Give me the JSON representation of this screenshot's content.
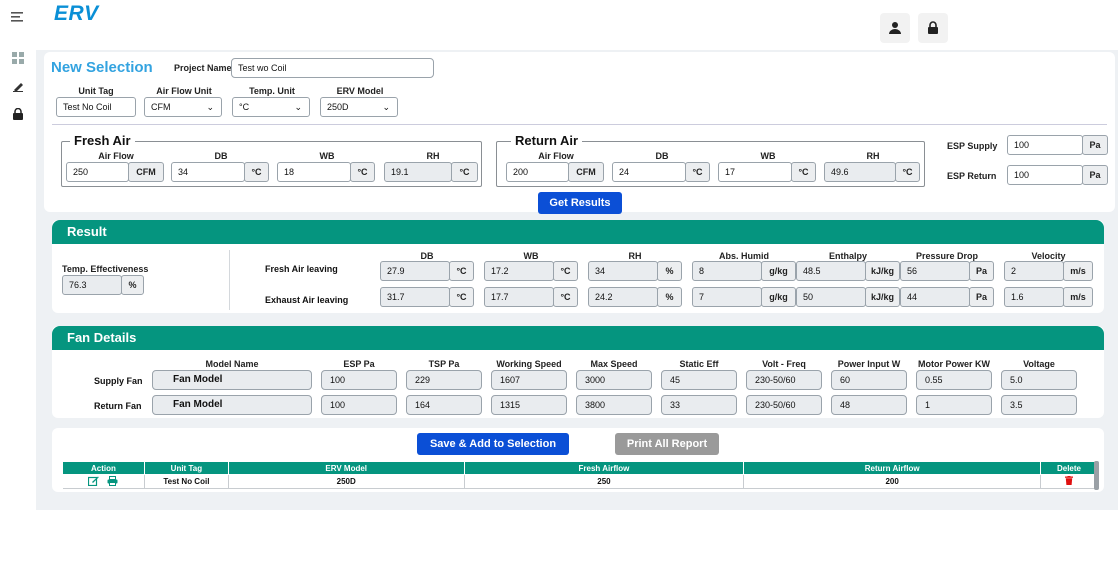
{
  "app": {
    "brand": "ERV"
  },
  "rail": {
    "icons": [
      "hamburger-icon",
      "grid-icon",
      "pen-icon",
      "lock-icon"
    ]
  },
  "header": {
    "title": "New Selection",
    "project_name_label": "Project Name",
    "project_name_value": "Test wo Coil"
  },
  "selectors": {
    "unit_tag": {
      "label": "Unit Tag",
      "value": "Test No Coil"
    },
    "airflow_unit": {
      "label": "Air Flow Unit",
      "value": "CFM"
    },
    "temp_unit": {
      "label": "Temp. Unit",
      "value": "°C"
    },
    "erv_model": {
      "label": "ERV Model",
      "value": "250D"
    }
  },
  "fresh_air": {
    "legend": "Fresh Air",
    "airflow": {
      "label": "Air Flow",
      "value": "250",
      "unit": "CFM"
    },
    "db": {
      "label": "DB",
      "value": "34",
      "unit": "°C"
    },
    "wb": {
      "label": "WB",
      "value": "18",
      "unit": "°C"
    },
    "rh": {
      "label": "RH",
      "value": "19.1",
      "unit": "°C"
    }
  },
  "return_air": {
    "legend": "Return Air",
    "airflow": {
      "label": "Air Flow",
      "value": "200",
      "unit": "CFM"
    },
    "db": {
      "label": "DB",
      "value": "24",
      "unit": "°C"
    },
    "wb": {
      "label": "WB",
      "value": "17",
      "unit": "°C"
    },
    "rh": {
      "label": "RH",
      "value": "49.6",
      "unit": "°C"
    }
  },
  "esp": {
    "supply": {
      "label": "ESP Supply",
      "value": "100",
      "unit": "Pa"
    },
    "return": {
      "label": "ESP Return",
      "value": "100",
      "unit": "Pa"
    }
  },
  "buttons": {
    "get_results": "Get Results",
    "save_add": "Save & Add to Selection",
    "print_all": "Print All Report"
  },
  "result": {
    "title": "Result",
    "temp_eff": {
      "label": "Temp. Effectiveness",
      "value": "76.3",
      "unit": "%"
    },
    "headers": [
      "DB",
      "WB",
      "RH",
      "Abs. Humid",
      "Enthalpy",
      "Pressure Drop",
      "Velocity"
    ],
    "rows": [
      {
        "label": "Fresh Air leaving",
        "values": [
          "27.9",
          "17.2",
          "34",
          "8",
          "48.5",
          "56",
          "2"
        ],
        "units": [
          "°C",
          "°C",
          "%",
          "g/kg",
          "kJ/kg",
          "Pa",
          "m/s"
        ]
      },
      {
        "label": "Exhaust Air leaving",
        "values": [
          "31.7",
          "17.7",
          "24.2",
          "7",
          "50",
          "44",
          "1.6"
        ],
        "units": [
          "°C",
          "°C",
          "%",
          "g/kg",
          "kJ/kg",
          "Pa",
          "m/s"
        ]
      }
    ]
  },
  "fan": {
    "title": "Fan Details",
    "headers": [
      "Model Name",
      "ESP Pa",
      "TSP Pa",
      "Working Speed",
      "Max Speed",
      "Static Eff",
      "Volt - Freq",
      "Power Input W",
      "Motor Power KW",
      "Voltage"
    ],
    "rows": [
      {
        "label": "Supply Fan",
        "values": [
          "Fan Model",
          "100",
          "229",
          "1607",
          "3000",
          "45",
          "230-50/60",
          "60",
          "0.55",
          "5.0"
        ]
      },
      {
        "label": "Return Fan",
        "values": [
          "Fan Model",
          "100",
          "164",
          "1315",
          "3800",
          "33",
          "230-50/60",
          "48",
          "1",
          "3.5"
        ]
      }
    ]
  },
  "summary_table": {
    "headers": [
      "Action",
      "Unit Tag",
      "ERV Model",
      "Fresh Airflow",
      "Return Airflow",
      "Delete"
    ],
    "rows": [
      {
        "unit_tag": "Test No Coil",
        "erv_model": "250D",
        "fresh_airflow": "250",
        "return_airflow": "200"
      }
    ]
  },
  "colors": {
    "accent": "#05957f",
    "brand": "#0a8fd6",
    "primary_button": "#0b4fd6",
    "secondary_button": "#9a9a9a",
    "delete": "#e01010"
  }
}
